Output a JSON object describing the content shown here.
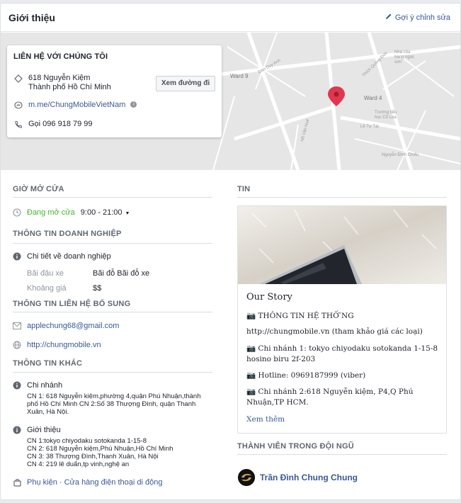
{
  "header": {
    "title": "Giới thiệu",
    "edit_label": "Gợi ý chỉnh sửa"
  },
  "map": {
    "labels": [
      "Ward 9",
      "Ward 4",
      "Nhà của hàng ngọc sơn",
      "Trường tiểu học Cổ Loa",
      "Nguyễn Đình Chiểu",
      "Thích Quảng Đức",
      "Hồ Văn Huê",
      "Lê Tự Tài",
      "Đào Duy Anh"
    ]
  },
  "contact": {
    "title": "LIÊN HỆ VỚI CHÚNG TÔI",
    "address_line1": "618 Nguyễn Kiệm",
    "address_line2": "Thành phố Hồ Chí Minh",
    "directions_label": "Xem đường đi",
    "messenger": "m.me/ChungMobileVietNam",
    "phone": "Gọi 096 918 79 99"
  },
  "hours": {
    "heading": "GIỜ MỞ CỬA",
    "status": "Đang mở cửa",
    "time": "9:00 - 21:00"
  },
  "business": {
    "heading": "THÔNG TIN DOANH NGHIỆP",
    "detail_label": "Chi tiết về doanh nghiệp",
    "parking_label": "Bãi đậu xe",
    "parking_value": "Bãi đỗ Bãi đỗ xe",
    "price_label": "Khoảng giá",
    "price_value": "$$"
  },
  "extra_contact": {
    "heading": "THÔNG TIN LIÊN HỆ BỔ SUNG",
    "email": "applechung68@gmail.com",
    "website": "http://chungmobile.vn"
  },
  "other": {
    "heading": "THÔNG TIN KHÁC",
    "branch_title": "Chi nhánh",
    "branch_lines": [
      "CN 1: 618 Nguyễn kiệm,phường 4,quận Phú Nhuận,thành",
      "phố Hồ Chí Minh CN 2:Số 38 Thượng Đình, quận Thanh",
      "Xuân, Hà Nội."
    ],
    "intro_title": "Giới thiệu",
    "intro_lines": [
      "CN 1:tokyo chiyodaku sotokanda 1-15-8",
      "CN 2: 618 Nguyễn kiệm,Phú Nhuận,Hồ Chí Minh",
      "CN 3: 38 Thượng Đình,Thanh Xuân, Hà Nội",
      "CN 4: 219 lê duẩn,tp vinh,nghệ an"
    ],
    "category": "Phụ kiện · Cửa hàng điện thoại di động"
  },
  "news": {
    "heading": "TIN",
    "story_title": "Our Story",
    "lines": [
      "📷 THÔNG TIN HỆ THỐ ̃NG",
      "http://chungmobile.vn (tham khảo giá các loại)",
      "📷 Chi nhánh 1: tokyo chiyodaku sotokanda 1-15-8",
      "hosino biru 2f-203",
      "📷 Hotline: 0969187999 (viber)",
      "📷 Chi nhánh 2:618 Nguyễn kiệm, P4,Q Phú",
      "Nhuận,TP HCM."
    ],
    "see_more": "Xem thêm"
  },
  "team": {
    "heading": "THÀNH VIÊN TRONG ĐỘI NGŨ",
    "member_name": "Trần Đình Chung Chung"
  },
  "colors": {
    "link": "#385898",
    "open_green": "#42b72a",
    "pin_red": "#e0374f"
  }
}
